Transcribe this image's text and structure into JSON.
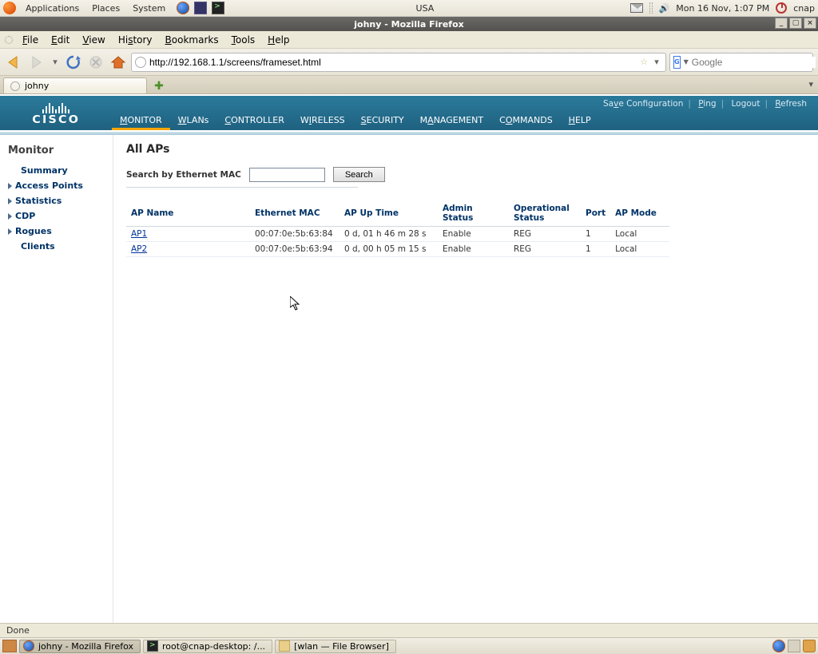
{
  "gnome_top": {
    "menus": [
      "Applications",
      "Places",
      "System"
    ],
    "input_indicator": "USA",
    "clock": "Mon 16 Nov,  1:07 PM",
    "user": "cnap"
  },
  "firefox": {
    "title": "johny - Mozilla Firefox",
    "menus": [
      "File",
      "Edit",
      "View",
      "History",
      "Bookmarks",
      "Tools",
      "Help"
    ],
    "url": "http://192.168.1.1/screens/frameset.html",
    "search_placeholder": "Google",
    "tab_label": "johny",
    "status": "Done"
  },
  "cisco": {
    "brand": "CISCO",
    "top_links": {
      "save": "Save Configuration",
      "ping": "Ping",
      "logout": "Logout",
      "refresh": "Refresh"
    },
    "nav": [
      {
        "label": "MONITOR",
        "u": "M",
        "active": true
      },
      {
        "label": "WLANs",
        "u": "W"
      },
      {
        "label": "CONTROLLER",
        "u": "C"
      },
      {
        "label": "WIRELESS",
        "u": "W"
      },
      {
        "label": "SECURITY",
        "u": "S"
      },
      {
        "label": "MANAGEMENT",
        "u": "M"
      },
      {
        "label": "COMMANDS",
        "u": "C"
      },
      {
        "label": "HELP",
        "u": "H"
      }
    ],
    "side_title": "Monitor",
    "side_items": [
      {
        "label": "Summary",
        "arrow": false
      },
      {
        "label": "Access Points",
        "arrow": true
      },
      {
        "label": "Statistics",
        "arrow": true
      },
      {
        "label": "CDP",
        "arrow": true
      },
      {
        "label": "Rogues",
        "arrow": true
      },
      {
        "label": "Clients",
        "arrow": false
      }
    ],
    "page_title": "All APs",
    "search_label": "Search by Ethernet MAC",
    "search_button": "Search",
    "columns": [
      "AP Name",
      "Ethernet MAC",
      "AP Up Time",
      "Admin Status",
      "Operational Status",
      "Port",
      "AP Mode"
    ],
    "rows": [
      {
        "name": "AP1",
        "mac": "00:07:0e:5b:63:84",
        "uptime": "0 d, 01 h 46 m 28 s",
        "admin": "Enable",
        "oper": "REG",
        "port": "1",
        "mode": "Local"
      },
      {
        "name": "AP2",
        "mac": "00:07:0e:5b:63:94",
        "uptime": "0 d, 00 h 05 m 15 s",
        "admin": "Enable",
        "oper": "REG",
        "port": "1",
        "mode": "Local"
      }
    ]
  },
  "gnome_bottom": {
    "tasks": [
      {
        "label": "johny - Mozilla Firefox",
        "icon": "firefox",
        "active": true
      },
      {
        "label": "root@cnap-desktop: /...",
        "icon": "terminal",
        "active": false
      },
      {
        "label": "[wlan — File Browser]",
        "icon": "folder",
        "active": false
      }
    ]
  }
}
